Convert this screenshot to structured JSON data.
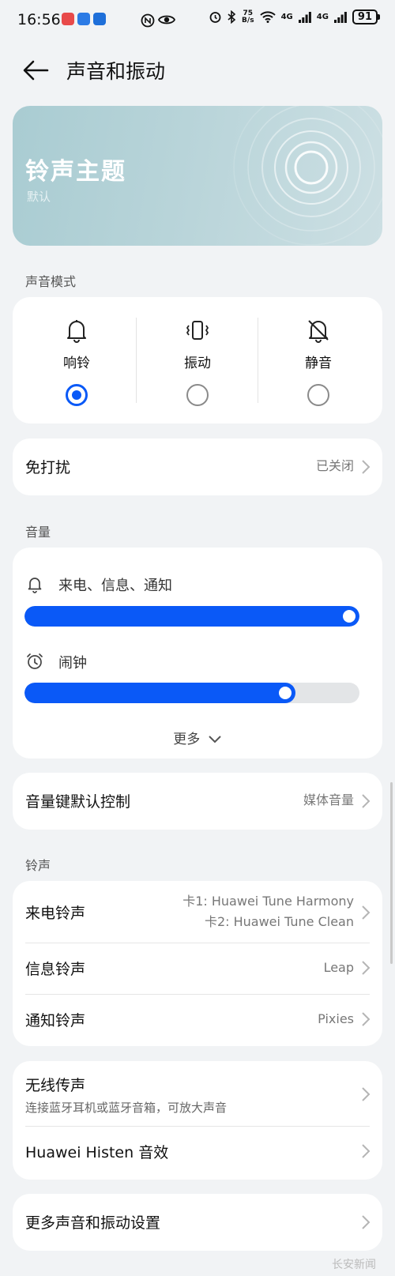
{
  "status_bar": {
    "time": "16:56",
    "net_speed_top": "75",
    "net_speed_bottom": "B/s",
    "sig1": "4G",
    "sig2": "4G",
    "battery": "91"
  },
  "header": {
    "title": "声音和振动"
  },
  "banner": {
    "title": "铃声主题",
    "subtitle": "默认"
  },
  "sound_mode": {
    "section": "声音模式",
    "options": [
      {
        "label": "响铃",
        "icon": "bell-icon",
        "selected": true
      },
      {
        "label": "振动",
        "icon": "vibrate-icon",
        "selected": false
      },
      {
        "label": "静音",
        "icon": "bell-off-icon",
        "selected": false
      }
    ]
  },
  "dnd": {
    "label": "免打扰",
    "value": "已关闭"
  },
  "volume": {
    "section": "音量",
    "ring": {
      "label": "来电、信息、通知",
      "level": 1.0
    },
    "alarm": {
      "label": "闹钟",
      "level": 0.81
    },
    "more": "更多"
  },
  "volume_key": {
    "label": "音量键默认控制",
    "value": "媒体音量"
  },
  "ringtones": {
    "section": "铃声",
    "call": {
      "label": "来电铃声",
      "sim1": "卡1: Huawei Tune Harmony",
      "sim2": "卡2: Huawei Tune Clean"
    },
    "message": {
      "label": "信息铃声",
      "value": "Leap"
    },
    "notification": {
      "label": "通知铃声",
      "value": "Pixies"
    }
  },
  "wireless": {
    "label": "无线传声",
    "desc": "连接蓝牙耳机或蓝牙音箱，可放大声音"
  },
  "histen": {
    "label": "Huawei Histen 音效"
  },
  "more_settings": {
    "label": "更多声音和振动设置"
  },
  "watermark": "长安新闻",
  "colors": {
    "accent": "#0a59f7",
    "background": "#f1f3f5",
    "card": "#ffffff"
  }
}
